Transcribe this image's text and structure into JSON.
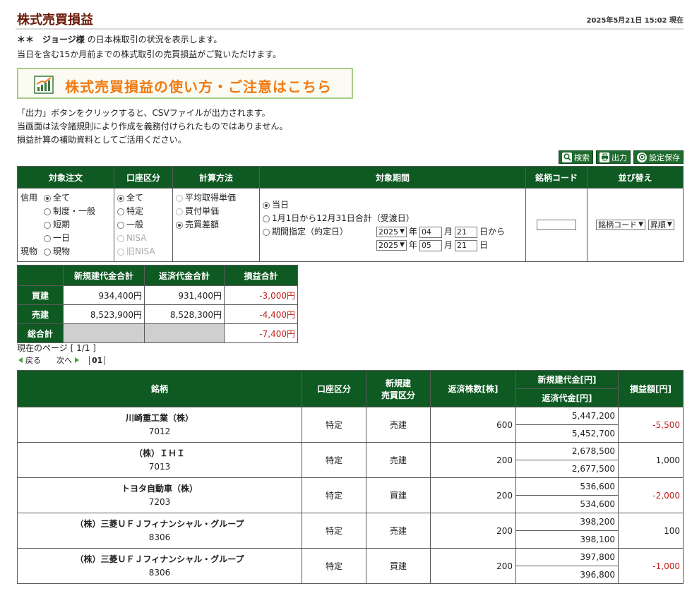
{
  "header": {
    "title": "株式売買損益",
    "timestamp": "2025年5月21日 15:02 現在"
  },
  "intro": {
    "prefix": "＊＊　",
    "user": "ジョージ様",
    "line1_suffix": " の日本株取引の状況を表示します。",
    "line2": "当日を含む15か月前までの株式取引の売買損益がご覧いただけます。"
  },
  "banner": {
    "text": "株式売買損益の使い方・ご注意はこちら"
  },
  "notes": [
    "「出力」ボタンをクリックすると、CSVファイルが出力されます。",
    "当画面は法令諸規則により作成を義務付けられたものではありません。",
    "損益計算の補助資料としてご活用ください。"
  ],
  "toolbar": {
    "search": "検索",
    "output": "出力",
    "save": "設定保存"
  },
  "filters": {
    "headers": [
      "対象注文",
      "口座区分",
      "計算方法",
      "対象期間",
      "銘柄コード",
      "並び替え"
    ],
    "order": {
      "credit_label": "信用",
      "spot_label": "現物",
      "credit_options": [
        "全て",
        "制度・一般",
        "短期",
        "一日"
      ],
      "spot_option": "現物"
    },
    "account": [
      "全て",
      "特定",
      "一般",
      "NISA",
      "旧NISA"
    ],
    "method": [
      "平均取得単価",
      "買付単価",
      "売買差額"
    ],
    "period": {
      "options": [
        "当日",
        "1月1日から12月31日合計（受渡日）",
        "期間指定（約定日）"
      ],
      "from_year": "2025",
      "from_month": "04",
      "from_day": "21",
      "to_year": "2025",
      "to_month": "05",
      "to_day": "21",
      "year_unit": "年",
      "month_unit": "月",
      "from_suffix": "日から",
      "to_suffix": "日"
    },
    "code_value": "",
    "sort": {
      "field": "銘柄コード",
      "order": "昇順"
    }
  },
  "summary": {
    "headers": [
      "新規建代金合計",
      "返済代金合計",
      "損益合計"
    ],
    "rows": [
      {
        "label": "買建",
        "open": "934,400円",
        "close": "931,400円",
        "pl": "-3,000円"
      },
      {
        "label": "売建",
        "open": "8,523,900円",
        "close": "8,528,300円",
        "pl": "-4,400円"
      }
    ],
    "total": {
      "label": "総合計",
      "pl": "-7,400円"
    }
  },
  "pager": {
    "current": "現在のページ [ 1/1 ]",
    "prev": "戻る",
    "next": "次へ",
    "page": "01"
  },
  "positions": {
    "headers": {
      "name": "銘柄",
      "account": "口座区分",
      "type_line1": "新規建",
      "type_line2": "売買区分",
      "qty": "返済株数[株]",
      "open_amt": "新規建代金[円]",
      "close_amt": "返済代金[円]",
      "pl": "損益額[円]"
    },
    "rows": [
      {
        "name": "川崎重工業（株）",
        "code": "7012",
        "account": "特定",
        "type": "売建",
        "qty": "600",
        "open": "5,447,200",
        "close": "5,452,700",
        "pl": "-5,500"
      },
      {
        "name": "（株）ＩＨＩ",
        "code": "7013",
        "account": "特定",
        "type": "売建",
        "qty": "200",
        "open": "2,678,500",
        "close": "2,677,500",
        "pl": "1,000"
      },
      {
        "name": "トヨタ自動車（株）",
        "code": "7203",
        "account": "特定",
        "type": "買建",
        "qty": "200",
        "open": "536,600",
        "close": "534,600",
        "pl": "-2,000"
      },
      {
        "name": "（株）三菱ＵＦＪフィナンシャル・グループ",
        "code": "8306",
        "account": "特定",
        "type": "売建",
        "qty": "200",
        "open": "398,200",
        "close": "398,100",
        "pl": "100"
      },
      {
        "name": "（株）三菱ＵＦＪフィナンシャル・グループ",
        "code": "8306",
        "account": "特定",
        "type": "買建",
        "qty": "200",
        "open": "397,800",
        "close": "396,800",
        "pl": "-1,000"
      }
    ]
  },
  "colors": {
    "header_green": "#0e5a22",
    "title_brown": "#6b1a0a",
    "banner_orange": "#f07a12",
    "negative_red": "#c0201c"
  }
}
